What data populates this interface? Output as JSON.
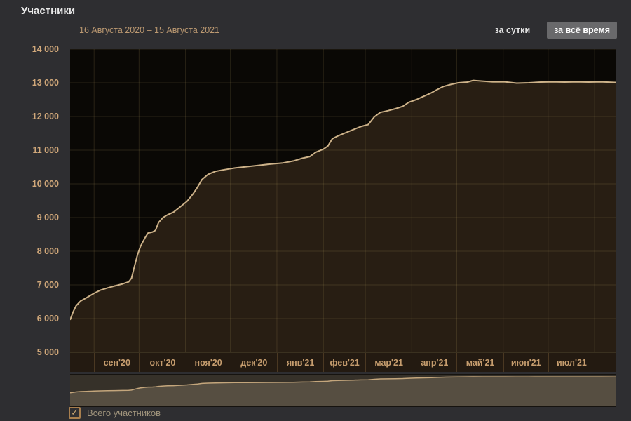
{
  "page": {
    "title": "Участники"
  },
  "header": {
    "date_range": "16 Августа 2020 – 15 Августа 2021",
    "range_buttons": [
      {
        "label": "за сутки",
        "active": false
      },
      {
        "label": "за всё время",
        "active": true
      }
    ]
  },
  "legend": {
    "label": "Всего участников",
    "checked": true
  },
  "chart_data": {
    "type": "area",
    "title": "Участники",
    "subtitle": "16 Августа 2020 – 15 Августа 2021",
    "xlabel": "",
    "ylabel": "",
    "x_range": [
      "2020-08-16",
      "2021-08-15"
    ],
    "ylim": [
      5000,
      14000
    ],
    "grid": true,
    "legend_position": "bottom",
    "y_ticks": [
      14000,
      13000,
      12000,
      11000,
      10000,
      9000,
      8000,
      7000,
      6000,
      5000
    ],
    "y_tick_labels": [
      "14 000",
      "13 000",
      "12 000",
      "11 000",
      "10 000",
      "9 000",
      "8 000",
      "7 000",
      "6 000",
      "5 000"
    ],
    "x_tick_labels": [
      "сен'20",
      "окт'20",
      "ноя'20",
      "дек'20",
      "янв'21",
      "фев'21",
      "мар'21",
      "апр'21",
      "май'21",
      "июн'21",
      "июл'21"
    ],
    "series": [
      {
        "name": "Всего участников",
        "points": [
          [
            "2020-08-16",
            5960
          ],
          [
            "2020-08-18",
            6200
          ],
          [
            "2020-08-20",
            6380
          ],
          [
            "2020-08-23",
            6520
          ],
          [
            "2020-08-27",
            6620
          ],
          [
            "2020-09-01",
            6750
          ],
          [
            "2020-09-05",
            6840
          ],
          [
            "2020-09-10",
            6910
          ],
          [
            "2020-09-15",
            6970
          ],
          [
            "2020-09-20",
            7030
          ],
          [
            "2020-09-24",
            7090
          ],
          [
            "2020-09-26",
            7200
          ],
          [
            "2020-09-28",
            7560
          ],
          [
            "2020-09-30",
            7900
          ],
          [
            "2020-10-02",
            8150
          ],
          [
            "2020-10-05",
            8400
          ],
          [
            "2020-10-07",
            8540
          ],
          [
            "2020-10-10",
            8570
          ],
          [
            "2020-10-12",
            8620
          ],
          [
            "2020-10-14",
            8850
          ],
          [
            "2020-10-17",
            9000
          ],
          [
            "2020-10-20",
            9080
          ],
          [
            "2020-10-24",
            9160
          ],
          [
            "2020-10-28",
            9300
          ],
          [
            "2020-11-02",
            9480
          ],
          [
            "2020-11-06",
            9700
          ],
          [
            "2020-11-09",
            9900
          ],
          [
            "2020-11-12",
            10130
          ],
          [
            "2020-11-16",
            10280
          ],
          [
            "2020-11-21",
            10370
          ],
          [
            "2020-11-27",
            10420
          ],
          [
            "2020-12-04",
            10470
          ],
          [
            "2020-12-12",
            10510
          ],
          [
            "2020-12-20",
            10550
          ],
          [
            "2020-12-28",
            10590
          ],
          [
            "2021-01-05",
            10620
          ],
          [
            "2021-01-12",
            10680
          ],
          [
            "2021-01-18",
            10760
          ],
          [
            "2021-01-23",
            10810
          ],
          [
            "2021-01-27",
            10940
          ],
          [
            "2021-02-01",
            11030
          ],
          [
            "2021-02-04",
            11120
          ],
          [
            "2021-02-07",
            11340
          ],
          [
            "2021-02-11",
            11430
          ],
          [
            "2021-02-16",
            11520
          ],
          [
            "2021-02-21",
            11610
          ],
          [
            "2021-02-26",
            11700
          ],
          [
            "2021-03-03",
            11760
          ],
          [
            "2021-03-07",
            11990
          ],
          [
            "2021-03-11",
            12120
          ],
          [
            "2021-03-16",
            12170
          ],
          [
            "2021-03-21",
            12230
          ],
          [
            "2021-03-26",
            12300
          ],
          [
            "2021-03-30",
            12420
          ],
          [
            "2021-04-04",
            12500
          ],
          [
            "2021-04-09",
            12600
          ],
          [
            "2021-04-14",
            12700
          ],
          [
            "2021-04-18",
            12800
          ],
          [
            "2021-04-22",
            12890
          ],
          [
            "2021-04-27",
            12950
          ],
          [
            "2021-05-02",
            13000
          ],
          [
            "2021-05-08",
            13020
          ],
          [
            "2021-05-12",
            13070
          ],
          [
            "2021-05-18",
            13050
          ],
          [
            "2021-05-25",
            13030
          ],
          [
            "2021-06-02",
            13030
          ],
          [
            "2021-06-10",
            12990
          ],
          [
            "2021-06-18",
            13000
          ],
          [
            "2021-06-26",
            13020
          ],
          [
            "2021-07-04",
            13030
          ],
          [
            "2021-07-12",
            13020
          ],
          [
            "2021-07-20",
            13030
          ],
          [
            "2021-07-28",
            13020
          ],
          [
            "2021-08-05",
            13030
          ],
          [
            "2021-08-15",
            13010
          ]
        ]
      }
    ],
    "colors": {
      "line": "#cdb289",
      "fill": "#281e13",
      "plot_bg": "#0a0805",
      "grid": "rgba(205,180,110,0.16)",
      "axis_label": "#d1a87a",
      "month_label": "#c69d6e",
      "band_bg": "#231a11",
      "band_sep": "#4a3822",
      "nav_bg": "#363129",
      "nav_fill": "#564e41",
      "nav_line": "#c4a67c",
      "accent": "#bd9a72"
    }
  }
}
